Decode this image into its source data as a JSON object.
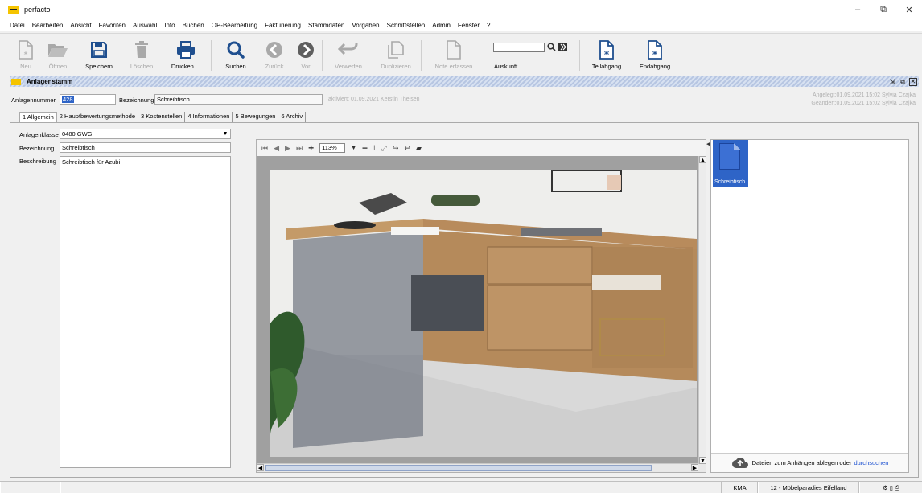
{
  "window": {
    "title": "perfacto",
    "minimize": "–",
    "restore": "⧉",
    "close": "✕"
  },
  "menu": [
    "Datei",
    "Bearbeiten",
    "Ansicht",
    "Favoriten",
    "Auswahl",
    "Info",
    "Buchen",
    "OP-Bearbeitung",
    "Fakturierung",
    "Stammdaten",
    "Vorgaben",
    "Schnittstellen",
    "Admin",
    "Fenster",
    "?"
  ],
  "toolbar": {
    "new": "Neu",
    "open": "Öffnen",
    "save": "Speichern",
    "delete": "Löschen",
    "print": "Drucken ...",
    "search": "Suchen",
    "back": "Zurück",
    "forward": "Vor",
    "discard": "Verwerfen",
    "duplicate": "Duplizieren",
    "note": "Note erfassen",
    "auskunft": "Auskunft",
    "teilabgang": "Teilabgang",
    "endabgang": "Endabgang",
    "auskunft_value": ""
  },
  "panel": {
    "title": "Anlagenstamm"
  },
  "header": {
    "anlagennummer_label": "Anlagennummer",
    "anlagennummer_value": "428",
    "bezeichnung_label": "Bezeichnung",
    "bezeichnung_value": "Schreibtisch",
    "aktiviert": "aktiviert: 01.09.2021 Kerstin Theisen",
    "angelegt": "Angelegt:01.09.2021 15:02 Sylvia Czajka",
    "geaendert": "Geändert:01.09.2021 15:02 Sylvia Czajka"
  },
  "tabs": [
    "1 Allgemein",
    "2 Hauptbewertungsmethode",
    "3 Kostenstellen",
    "4 Informationen",
    "5 Bewegungen",
    "6 Archiv"
  ],
  "form": {
    "anlagenklasse_label": "Anlagenklasse",
    "anlagenklasse_value": "0480 GWG",
    "bezeichnung_label": "Bezeichnung",
    "bezeichnung_value": "Schreibtisch",
    "beschreibung_label": "Beschreibung",
    "beschreibung_value": "Schreibtisch für Azubi"
  },
  "viewer": {
    "zoom": "113%"
  },
  "attachments": {
    "items": [
      {
        "name": "Schreibtisch"
      }
    ],
    "drop_text": "Dateien zum Anhängen ablegen oder",
    "drop_link": "durchsuchen"
  },
  "status": {
    "user": "KMA",
    "company": "12 - Möbelparadies Eifelland"
  },
  "colors": {
    "accent": "#2e64c7",
    "logo": "#f5c400",
    "icon_dark": "#1f4f8f",
    "icon_disabled": "#a9a9a9"
  }
}
